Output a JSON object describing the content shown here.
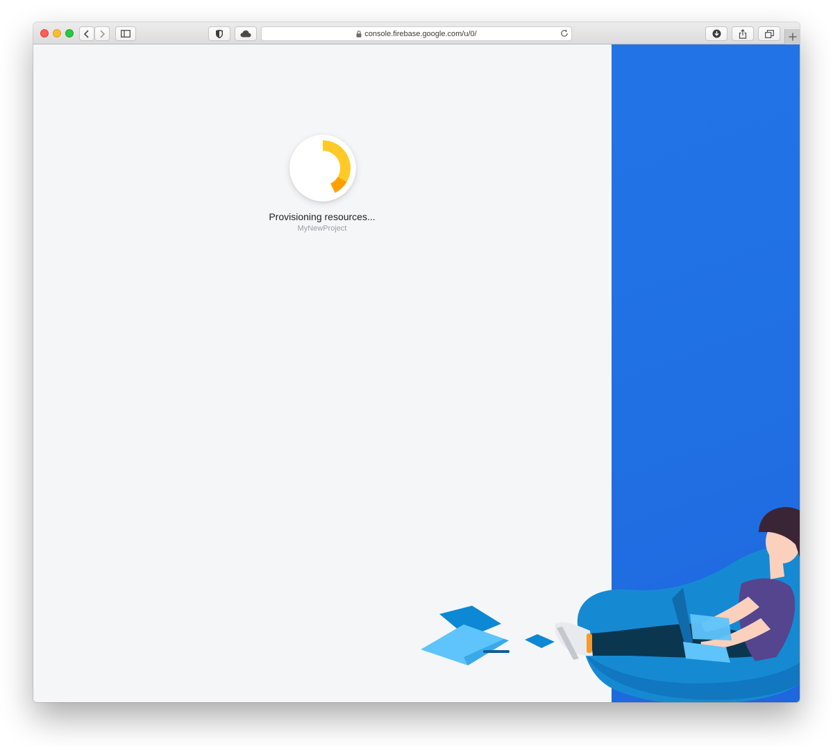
{
  "browser": {
    "url": "console.firebase.google.com/u/0/",
    "icons": {
      "back": "chevron-left-icon",
      "forward": "chevron-right-icon",
      "sidebar": "sidebar-icon",
      "shield": "shield-icon",
      "cloud": "cloud-icon",
      "lock": "lock-icon",
      "reload": "reload-icon",
      "download": "download-icon",
      "share": "share-icon",
      "tabs": "tabs-overview-icon",
      "new_tab": "plus-icon"
    }
  },
  "loader": {
    "status": "Provisioning resources...",
    "project_name": "MyNewProject"
  },
  "colors": {
    "panel_blue": "#2274e6",
    "spinner_yellow": "#ffca28",
    "spinner_orange": "#ffa000",
    "page_background": "#f5f6f8"
  }
}
